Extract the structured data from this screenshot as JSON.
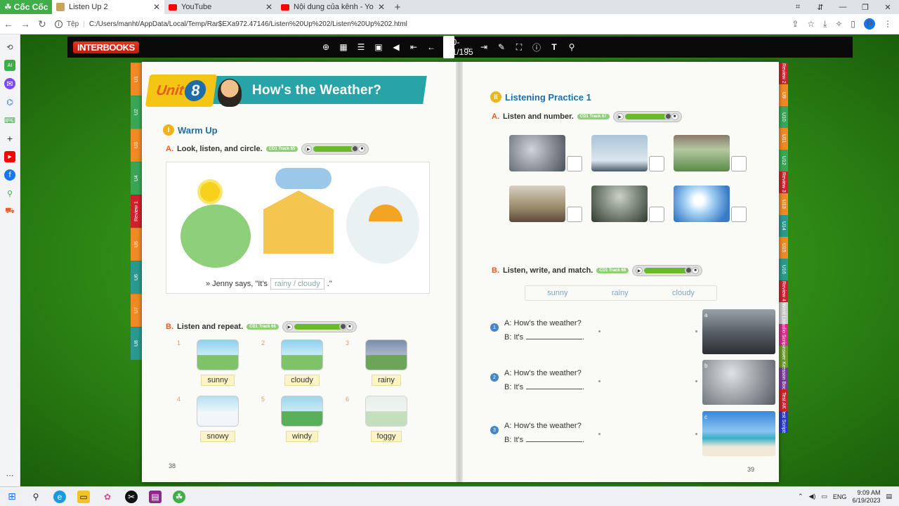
{
  "browser": {
    "logo_label": "Cốc Cốc",
    "tabs": [
      {
        "title": "Listen Up 2",
        "icon": "book-icon",
        "active": true
      },
      {
        "title": "YouTube",
        "icon": "youtube-icon",
        "active": false
      },
      {
        "title": "Nội dung của kênh - YouTube",
        "icon": "youtube-icon",
        "active": false
      }
    ],
    "address_scheme_label": "Tệp",
    "address_url": "C:/Users/manht/AppData/Local/Temp/Rar$EXa972.47146/Listen%20Up%202/Listen%20Up%202.html",
    "profile_initial": "P"
  },
  "viewer": {
    "brand": "INTERBOOKS",
    "page_indicator": "40-41/195"
  },
  "left_page": {
    "unit_word": "Unit",
    "unit_number": "8",
    "title": "How's the Weather?",
    "section_roman": "I",
    "section_title": "Warm Up",
    "part_a_letter": "A.",
    "part_a_instruction": "Look, listen, and circle.",
    "part_a_track": "CD1 Track 65",
    "jenny_prefix": "» Jenny says, \"It's",
    "jenny_options": "rainy / cloudy",
    "jenny_suffix": ".\"",
    "part_b_letter": "B.",
    "part_b_instruction": "Listen and repeat.",
    "part_b_track": "CD1 Track 66",
    "words": [
      {
        "num": "1",
        "word": "sunny"
      },
      {
        "num": "2",
        "word": "cloudy"
      },
      {
        "num": "3",
        "word": "rainy"
      },
      {
        "num": "4",
        "word": "snowy"
      },
      {
        "num": "5",
        "word": "windy"
      },
      {
        "num": "6",
        "word": "foggy"
      }
    ],
    "page_number": "38"
  },
  "right_page": {
    "section_roman": "II",
    "section_title": "Listening Practice 1",
    "part_a_letter": "A.",
    "part_a_instruction": "Listen and number.",
    "part_a_track": "CD1 Track 67",
    "part_b_letter": "B.",
    "part_b_instruction": "Listen, write, and match.",
    "part_b_track": "CD1 Track 68",
    "word_bank": [
      "sunny",
      "rainy",
      "cloudy"
    ],
    "questions": [
      {
        "num": "1",
        "q": "A: How's the weather?",
        "a": "B: It's"
      },
      {
        "num": "2",
        "q": "A: How's the weather?",
        "a": "B: It's"
      },
      {
        "num": "3",
        "q": "A: How's the weather?",
        "a": "B: It's"
      }
    ],
    "match_labels": [
      "a",
      "b",
      "c"
    ],
    "page_number": "39"
  },
  "left_tabs": [
    {
      "label": "U1",
      "color": "#f08a24"
    },
    {
      "label": "U2",
      "color": "#3aa655"
    },
    {
      "label": "U3",
      "color": "#f08a24"
    },
    {
      "label": "U4",
      "color": "#3aa655"
    },
    {
      "label": "Review 1",
      "color": "#d0202e"
    },
    {
      "label": "U5",
      "color": "#f08a24"
    },
    {
      "label": "U6",
      "color": "#2a9a8e"
    },
    {
      "label": "U7",
      "color": "#f08a24"
    },
    {
      "label": "U8",
      "color": "#2a9a8e"
    }
  ],
  "right_tabs": [
    {
      "label": "Review 2",
      "color": "#d0202e"
    },
    {
      "label": "U9",
      "color": "#f08a24"
    },
    {
      "label": "U10",
      "color": "#3aa655"
    },
    {
      "label": "U11",
      "color": "#f08a24"
    },
    {
      "label": "U12",
      "color": "#3aa655"
    },
    {
      "label": "Review 3",
      "color": "#d0202e"
    },
    {
      "label": "U13",
      "color": "#f08a24"
    },
    {
      "label": "U14",
      "color": "#2a9a8e"
    },
    {
      "label": "U15",
      "color": "#f08a24"
    },
    {
      "label": "U16",
      "color": "#2a9a8e"
    },
    {
      "label": "Review 4",
      "color": "#d0202e"
    },
    {
      "label": "Word List",
      "color": "#c8c8c8"
    },
    {
      "label": "Audio Scripts",
      "color": "#d62b8c"
    },
    {
      "label": "Answer Key",
      "color": "#6b9a2a"
    },
    {
      "label": "Lesson Book",
      "color": "#7a3a9a"
    },
    {
      "label": "Test AK",
      "color": "#d0202e"
    },
    {
      "label": "Test Scripts",
      "color": "#2a3ad0"
    }
  ],
  "taskbar": {
    "lang": "ENG",
    "time": "9:09 AM",
    "date": "6/19/2023"
  }
}
